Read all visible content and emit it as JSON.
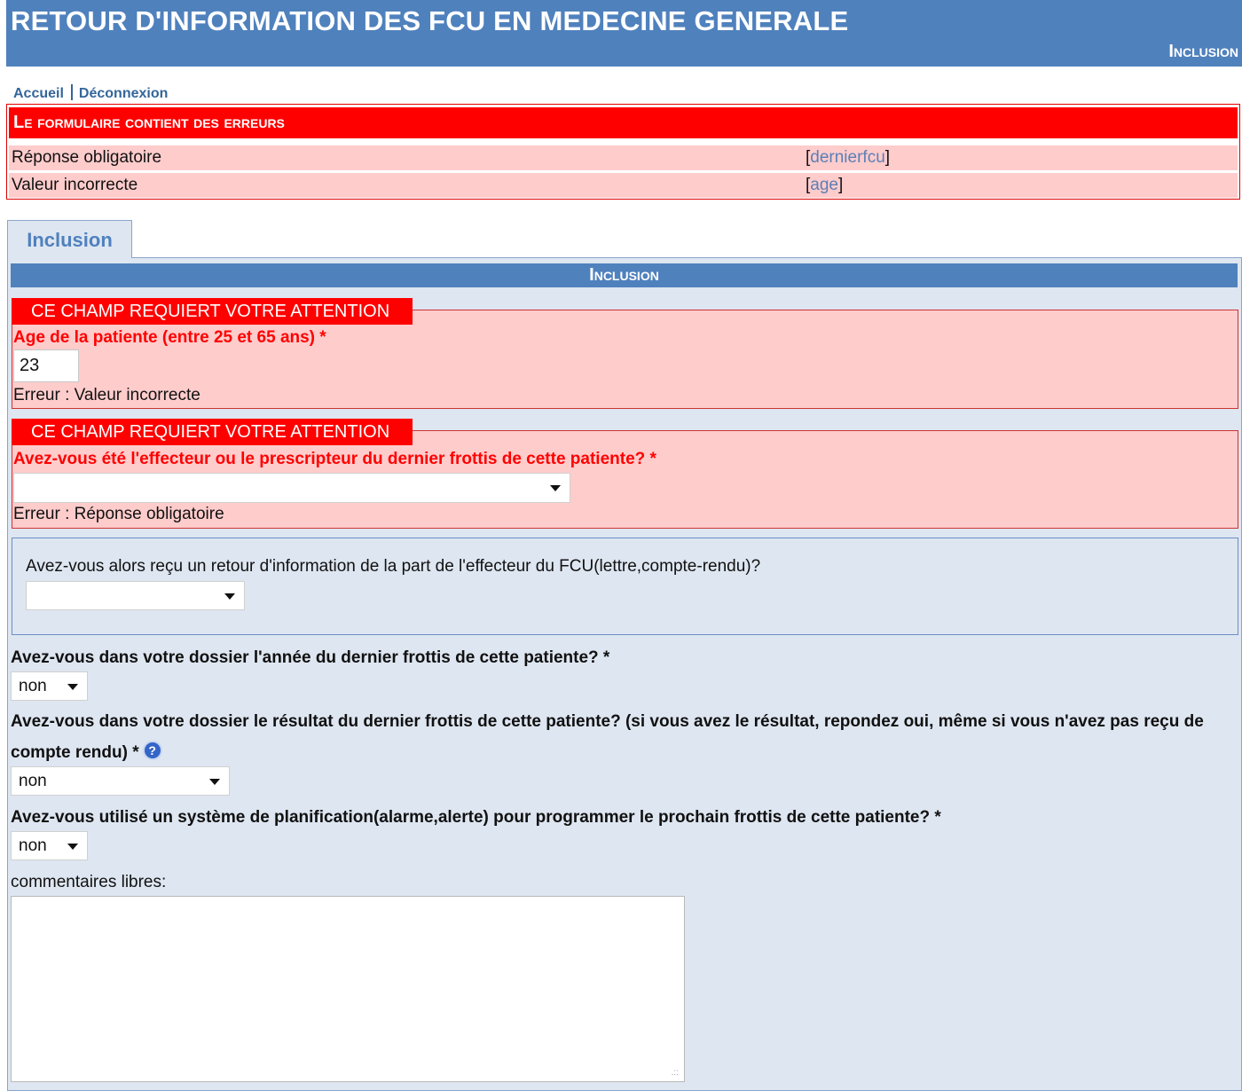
{
  "header": {
    "title": "RETOUR D'INFORMATION DES FCU EN MEDECINE GENERALE",
    "section": "Inclusion"
  },
  "nav": {
    "home": "Accueil",
    "logout": "Déconnexion"
  },
  "errors": {
    "title": "Le formulaire contient des erreurs",
    "rows": [
      {
        "message": "Réponse obligatoire",
        "open": "[",
        "field": "dernierfcu",
        "close": "]"
      },
      {
        "message": "Valeur incorrecte",
        "open": "[",
        "field": "age",
        "close": "]"
      }
    ]
  },
  "tab": {
    "label": "Inclusion"
  },
  "section_title": "Inclusion",
  "fields": {
    "age": {
      "attention": "CE CHAMP REQUIERT VOTRE ATTENTION",
      "label": "Age de la patiente (entre 25 et 65 ans) *",
      "value": "23",
      "error": "Erreur : Valeur incorrecte"
    },
    "dernierfcu": {
      "attention": "CE CHAMP REQUIERT VOTRE ATTENTION",
      "label": "Avez-vous été l'effecteur ou le prescripteur du dernier frottis de cette patiente? *",
      "value": "",
      "error": "Erreur : Réponse obligatoire"
    },
    "retour": {
      "label": "Avez-vous alors reçu un retour d'information de la part de l'effecteur du FCU(lettre,compte-rendu)?",
      "value": ""
    },
    "annee": {
      "label": "Avez-vous dans votre dossier l'année du dernier frottis de cette patiente? *",
      "value": "non"
    },
    "resultat": {
      "label": "Avez-vous dans votre dossier le résultat du dernier frottis de cette patiente? (si vous avez le résultat, repondez oui, même si vous n'avez pas reçu de compte rendu) *",
      "value": "non",
      "help_icon": "help-icon"
    },
    "planification": {
      "label": "Avez-vous utilisé un système de planification(alarme,alerte) pour programmer le prochain frottis de cette patiente? *",
      "value": "non"
    },
    "commentaires": {
      "label": "commentaires libres:",
      "value": ""
    }
  },
  "colors": {
    "header_blue": "#4f81bd",
    "panel_bg": "#dee6f1",
    "error_red": "#ff0000",
    "error_bg": "#ffcccc"
  }
}
